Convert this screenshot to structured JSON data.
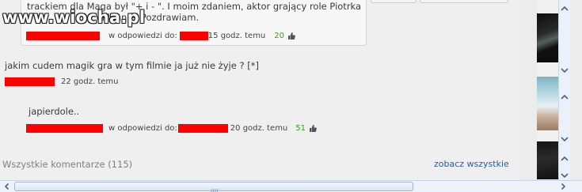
{
  "reply": {
    "lines": [
      "trackiem dla Maga był \"+ i - \". I moim zdaniem, aktor grający role Piotrka",
      "                        ekłonnie. Pozdrawiam."
    ],
    "reply_to_label": "w odpowiedzi do:",
    "time": "15 godz. temu",
    "score": "20"
  },
  "comment": {
    "text": "jakim cudem magik gra w tym filmie ja już nie żyje ? [*]",
    "time": "22 godz. temu"
  },
  "reply2": {
    "text": "japierdole..",
    "reply_to_label": "w odpowiedzi do:",
    "time": "20 godz. temu",
    "score": "51"
  },
  "footer": {
    "all_comments_label": "Wszystkie komentarze (115)",
    "see_all_link": "zobacz wszystkie"
  },
  "watermark": {
    "text": "www.wiocha.pl"
  },
  "colors": {
    "redaction": "#ff0000",
    "score": "#3b9c1e",
    "link": "#2a5aa8"
  }
}
